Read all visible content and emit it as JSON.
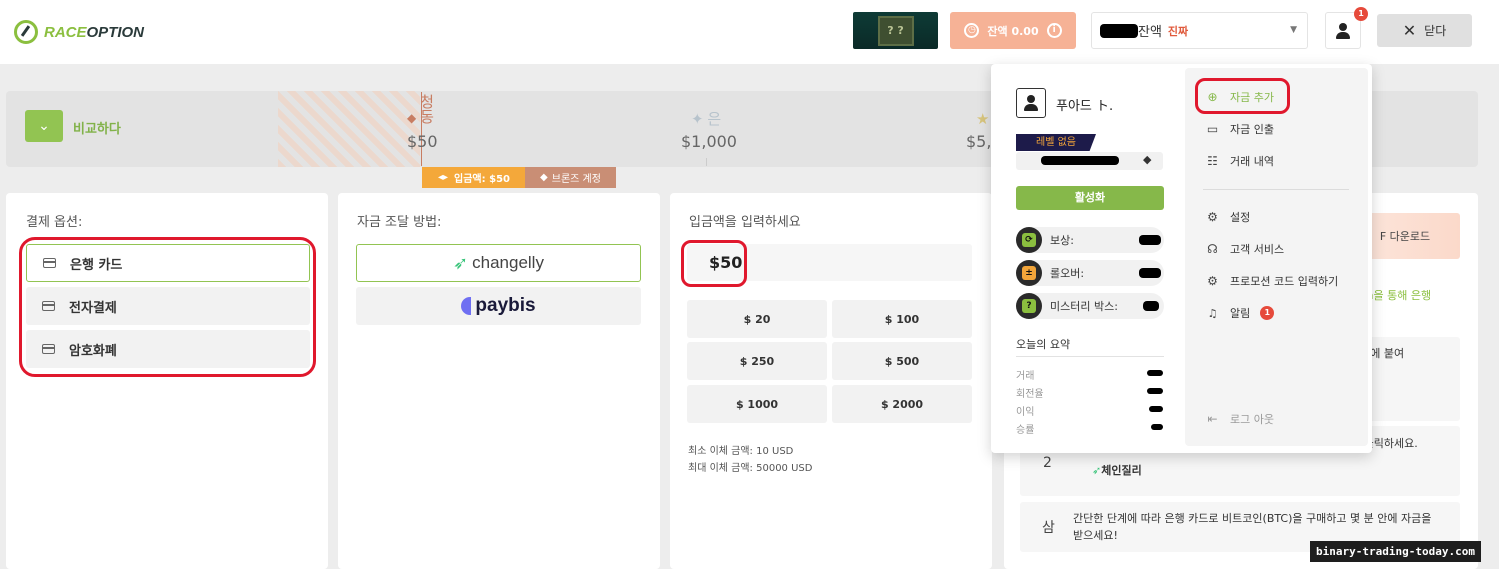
{
  "header": {
    "logo_race": "RACE",
    "logo_option": "OPTION",
    "mystery_box_label": "? ?",
    "balance_label": "잔액 0.00",
    "balance_info_icon": "i",
    "account_name_suffix": "잔액",
    "account_type": "진짜",
    "notification_count": "1",
    "close_label": "닫다"
  },
  "compare": {
    "button_label": "비교하다",
    "tiers": [
      {
        "name": "청동",
        "amount": "$50",
        "icon": "◆",
        "color": "#c87d62"
      },
      {
        "name": "은",
        "amount": "$1,000",
        "icon": "✦",
        "color": "#b7c3cc"
      },
      {
        "name": "",
        "amount": "$5,",
        "icon": "★",
        "color": "#d8c57d"
      }
    ],
    "deposit_tag": "입금액: $50",
    "deposit_tag_icon": "◂▸",
    "account_tag": "브론즈 계정",
    "account_tag_icon": "◆"
  },
  "payment": {
    "title": "결제 옵션:",
    "options": [
      "은행 카드",
      "전자결제",
      "암호화폐"
    ]
  },
  "funding": {
    "title": "자금 조달 방법:",
    "methods": [
      "changelly",
      "paybis"
    ]
  },
  "amount": {
    "title": "입금액을 입력하세요",
    "value": "$50",
    "presets": [
      "$ 20",
      "$ 100",
      "$ 250",
      "$ 500",
      "$ 1000",
      "$ 2000"
    ],
    "min_label": "최소 이체 금액: 10 USD",
    "max_label": "최대 이체 금액: 50000 USD"
  },
  "profile": {
    "name": "푸아드 ト.",
    "level": "레벨 없음",
    "activate_label": "활성화",
    "stats": [
      {
        "label": "보상:",
        "icon": "reward-icon",
        "symbol": "⟳",
        "color": "#8bbf3f"
      },
      {
        "label": "롤오버:",
        "icon": "rollover-icon",
        "symbol": "±",
        "color": "#f2a53a"
      },
      {
        "label": "미스터리 박스:",
        "icon": "mystery-icon",
        "symbol": "?",
        "color": "#8bbf3f"
      }
    ],
    "summary_title": "오늘의 요약",
    "summary_items": [
      "거래",
      "회전율",
      "이익",
      "승률"
    ]
  },
  "menu": {
    "items": [
      {
        "label": "자금 추가",
        "icon": "plus-circle-icon",
        "symbol": "⊕",
        "highlight": true
      },
      {
        "label": "자금 인출",
        "icon": "wallet-icon",
        "symbol": "▭"
      },
      {
        "label": "거래 내역",
        "icon": "history-icon",
        "symbol": "☷"
      },
      {
        "label": "설정",
        "icon": "gear-icon",
        "symbol": "⚙"
      },
      {
        "label": "고객 서비스",
        "icon": "headset-icon",
        "symbol": "☊"
      },
      {
        "label": "프로모션 코드 입력하기",
        "icon": "gear-icon",
        "symbol": "⚙"
      },
      {
        "label": "알림",
        "icon": "bell-icon",
        "symbol": "🔔",
        "badge": "1"
      }
    ],
    "logout_label": "로그 아웃"
  },
  "instructions": {
    "pdf_label": "F 다운로드",
    "via_text": "com을 통해 은행",
    "step1_fragment": "이트에 붙여",
    "step1b_fragment": "를 클릭하세요.",
    "step2_num": "2",
    "step2_text": "체인질리",
    "step3_num": "삼",
    "step3_text": "간단한 단계에 따라 은행 카드로 비트코인(BTC)을 구매하고 몇 분 안에 자금을 받으세요!"
  },
  "watermark": "binary-trading-today.com"
}
